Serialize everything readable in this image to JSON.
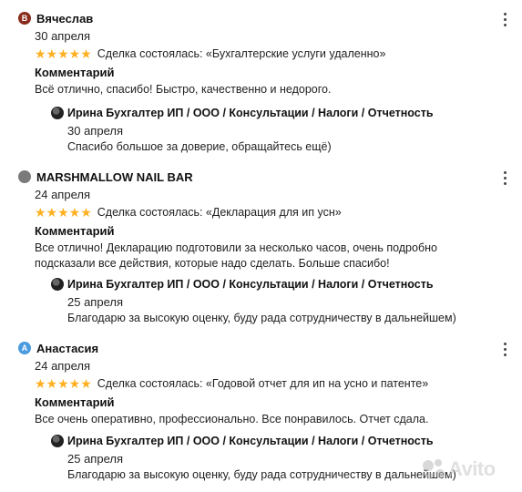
{
  "reviews": [
    {
      "author": "Вячеслав",
      "avatar_letter": "В",
      "avatar_color": "#8a2b1d",
      "date": "30 апреля",
      "stars": "★★★★★",
      "rating": 5,
      "deal": "Сделка состоялась: «Бухгалтерские услуги удаленно»",
      "comment_heading": "Комментарий",
      "comment": "Всё отлично, спасибо! Быстро, качественно и недорого.",
      "reply": {
        "author": "Ирина Бухгалтер ИП / ООО / Консультации / Налоги / Отчетность",
        "date": "30 апреля",
        "text": "Спасибо большое за доверие, обращайтесь ещё)"
      }
    },
    {
      "author": "MARSHMALLOW NAIL BAR",
      "avatar_letter": "",
      "avatar_color": "#7a7a7a",
      "date": "24 апреля",
      "stars": "★★★★★",
      "rating": 5,
      "deal": "Сделка состоялась: «Декларация для ип усн»",
      "comment_heading": "Комментарий",
      "comment": "Все отлично! Декларацию подготовили за несколько часов, очень подробно подсказали все действия, которые надо сделать. Больше спасибо!",
      "reply": {
        "author": "Ирина Бухгалтер ИП / ООО / Консультации / Налоги / Отчетность",
        "date": "25 апреля",
        "text": "Благодарю за высокую оценку, буду рада сотрудничеству в дальнейшем)"
      }
    },
    {
      "author": "Анастасия",
      "avatar_letter": "А",
      "avatar_color": "#4a9be0",
      "date": "24 апреля",
      "stars": "★★★★★",
      "rating": 5,
      "deal": "Сделка состоялась: «Годовой отчет для ип на усно и патенте»",
      "comment_heading": "Комментарий",
      "comment": "Все очень оперативно, профессионально. Все понравилось. Отчет сдала.",
      "reply": {
        "author": "Ирина Бухгалтер ИП / ООО / Консультации / Налоги / Отчетность",
        "date": "25 апреля",
        "text": "Благодарю за высокую оценку, буду рада сотрудничеству в дальнейшем)"
      }
    }
  ],
  "watermark": "Avito",
  "colors": {
    "star": "#ffb021",
    "text": "#1a1a1a"
  }
}
